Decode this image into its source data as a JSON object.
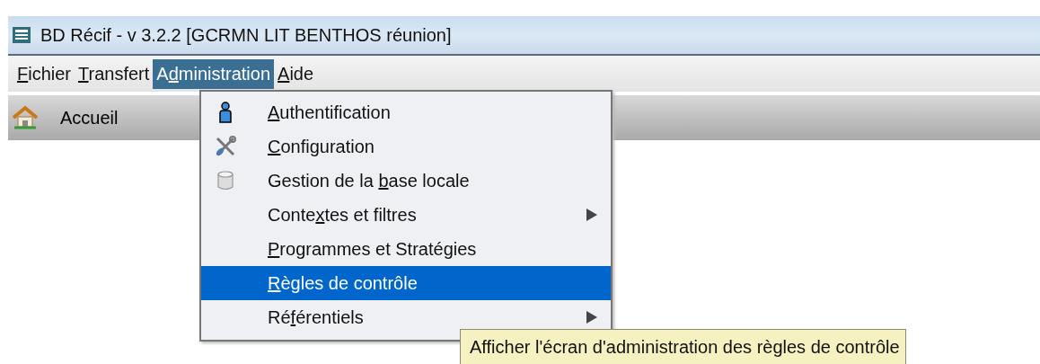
{
  "window": {
    "title": "BD Récif - v 3.2.2 [GCRMN LIT BENTHOS réunion]"
  },
  "menubar": [
    {
      "label": {
        "key": "F",
        "after": "ichier"
      },
      "selected": false
    },
    {
      "label": {
        "key": "T",
        "after": "ransfert"
      },
      "selected": false
    },
    {
      "label": {
        "before": "A",
        "key": "d",
        "after": "ministration"
      },
      "selected": true
    },
    {
      "label": {
        "key": "A",
        "after": "ide"
      },
      "selected": false
    }
  ],
  "toolbar": {
    "label": "Accueil"
  },
  "menu": [
    {
      "label": {
        "key": "A",
        "after": "uthentification"
      },
      "kind": "user",
      "selected": false
    },
    {
      "label": {
        "key": "C",
        "after": "onfiguration"
      },
      "kind": "tools",
      "selected": false
    },
    {
      "label": {
        "before": "Gestion de la ",
        "key": "b",
        "after": "ase locale"
      },
      "kind": "database",
      "selected": false
    },
    {
      "label": {
        "before": "Conte",
        "key": "x",
        "after": "tes et filtres"
      },
      "kind": "submenu",
      "selected": false
    },
    {
      "label": {
        "key": "P",
        "after": "rogrammes et Stratégies"
      },
      "kind": "plain",
      "selected": false
    },
    {
      "label": {
        "key": "R",
        "after": "ègles de contrôle"
      },
      "kind": "plain",
      "selected": true
    },
    {
      "label": {
        "before": "Ré",
        "key": "f",
        "after": "érentiels"
      },
      "kind": "submenu",
      "selected": false
    }
  ],
  "tooltip": "Afficher l'écran d'administration des règles de contrôle"
}
